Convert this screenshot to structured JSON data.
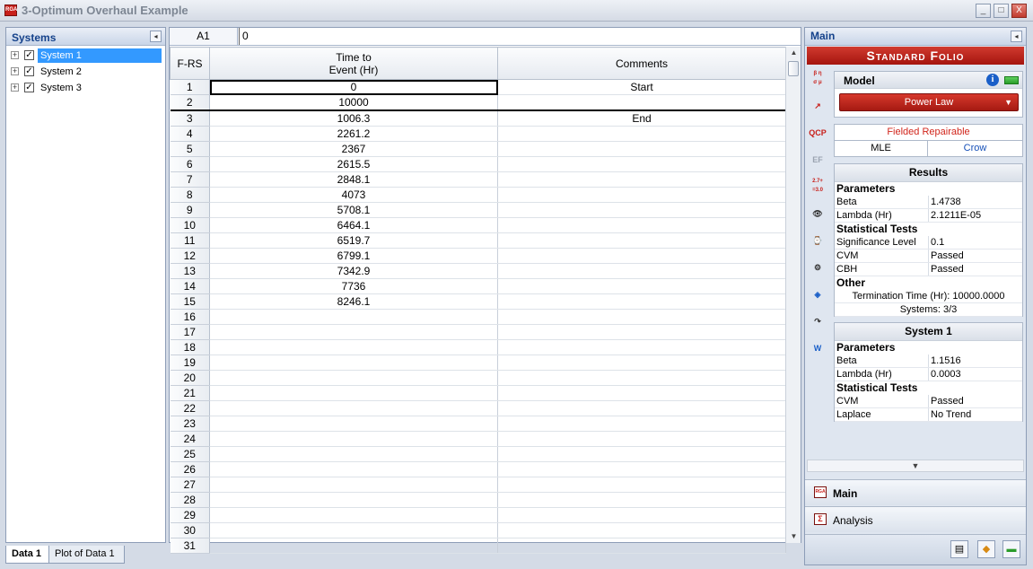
{
  "window": {
    "title": "3-Optimum Overhaul Example",
    "app_icon": "RGA",
    "minimize": "_",
    "maximize": "□",
    "close": "X"
  },
  "left_panel": {
    "header": "Systems",
    "collapse_glyph": "◂",
    "items": [
      {
        "label": "System 1",
        "checked": true,
        "selected": true
      },
      {
        "label": "System 2",
        "checked": true,
        "selected": false
      },
      {
        "label": "System 3",
        "checked": true,
        "selected": false
      }
    ]
  },
  "sheet_tabs": [
    "Data 1",
    "Plot of Data 1"
  ],
  "formula_bar": {
    "cell_ref": "A1",
    "value": "0"
  },
  "grid": {
    "corner": "F-RS",
    "columns": [
      "Time to\nEvent (Hr)",
      "Comments"
    ],
    "rows": [
      {
        "n": "1",
        "time": "0",
        "comment": "Start"
      },
      {
        "n": "2",
        "time": "10000",
        "comment": ""
      },
      {
        "n": "3",
        "time": "1006.3",
        "comment": "End"
      },
      {
        "n": "4",
        "time": "2261.2",
        "comment": ""
      },
      {
        "n": "5",
        "time": "2367",
        "comment": ""
      },
      {
        "n": "6",
        "time": "2615.5",
        "comment": ""
      },
      {
        "n": "7",
        "time": "2848.1",
        "comment": ""
      },
      {
        "n": "8",
        "time": "4073",
        "comment": ""
      },
      {
        "n": "9",
        "time": "5708.1",
        "comment": ""
      },
      {
        "n": "10",
        "time": "6464.1",
        "comment": ""
      },
      {
        "n": "11",
        "time": "6519.7",
        "comment": ""
      },
      {
        "n": "12",
        "time": "6799.1",
        "comment": ""
      },
      {
        "n": "13",
        "time": "7342.9",
        "comment": ""
      },
      {
        "n": "14",
        "time": "7736",
        "comment": ""
      },
      {
        "n": "15",
        "time": "8246.1",
        "comment": ""
      },
      {
        "n": "16",
        "time": "",
        "comment": ""
      },
      {
        "n": "17",
        "time": "",
        "comment": ""
      },
      {
        "n": "18",
        "time": "",
        "comment": ""
      },
      {
        "n": "19",
        "time": "",
        "comment": ""
      },
      {
        "n": "20",
        "time": "",
        "comment": ""
      },
      {
        "n": "21",
        "time": "",
        "comment": ""
      },
      {
        "n": "22",
        "time": "",
        "comment": ""
      },
      {
        "n": "23",
        "time": "",
        "comment": ""
      },
      {
        "n": "24",
        "time": "",
        "comment": ""
      },
      {
        "n": "25",
        "time": "",
        "comment": ""
      },
      {
        "n": "26",
        "time": "",
        "comment": ""
      },
      {
        "n": "27",
        "time": "",
        "comment": ""
      },
      {
        "n": "28",
        "time": "",
        "comment": ""
      },
      {
        "n": "29",
        "time": "",
        "comment": ""
      },
      {
        "n": "30",
        "time": "",
        "comment": ""
      },
      {
        "n": "31",
        "time": "",
        "comment": ""
      }
    ]
  },
  "right_panel": {
    "header": "Main",
    "banner": "Standard Folio",
    "tools": [
      "β η\nσ μ",
      "↗",
      "QCP",
      "EF",
      "2.7+\n=3.0",
      "👁",
      "⌚",
      "⚙",
      "◈",
      "↷",
      "W"
    ],
    "model": {
      "label": "Model",
      "value": "Power Law",
      "info_glyph": "i"
    },
    "settings": {
      "data_type": "Fielded Repairable",
      "method": "MLE",
      "grouping": "Crow"
    },
    "results": {
      "title": "Results",
      "parameters_header": "Parameters",
      "parameters": [
        {
          "k": "Beta",
          "v": "1.4738"
        },
        {
          "k": "Lambda (Hr)",
          "v": "2.1211E-05"
        }
      ],
      "tests_header": "Statistical Tests",
      "tests": [
        {
          "k": "Significance Level",
          "v": "0.1"
        },
        {
          "k": "CVM",
          "v": "Passed"
        },
        {
          "k": "CBH",
          "v": "Passed"
        }
      ],
      "other_header": "Other",
      "termination": "Termination Time (Hr): 10000.0000",
      "systems": "Systems: 3/3"
    },
    "system": {
      "title": "System 1",
      "parameters_header": "Parameters",
      "parameters": [
        {
          "k": "Beta",
          "v": "1.1516"
        },
        {
          "k": "Lambda (Hr)",
          "v": "0.0003"
        }
      ],
      "tests_header": "Statistical Tests",
      "tests": [
        {
          "k": "CVM",
          "v": "Passed"
        },
        {
          "k": "Laplace",
          "v": "No Trend"
        }
      ]
    },
    "nav": [
      {
        "label": "Main",
        "icon": "RGA"
      },
      {
        "label": "Analysis",
        "icon": "Σ"
      }
    ],
    "expand_glyph": "▼",
    "footer_buttons": [
      "▤",
      "◆",
      "▬"
    ]
  },
  "colors": {
    "accent_red": "#c8201b",
    "selection_blue": "#3399ff",
    "link_blue": "#1650b8"
  }
}
